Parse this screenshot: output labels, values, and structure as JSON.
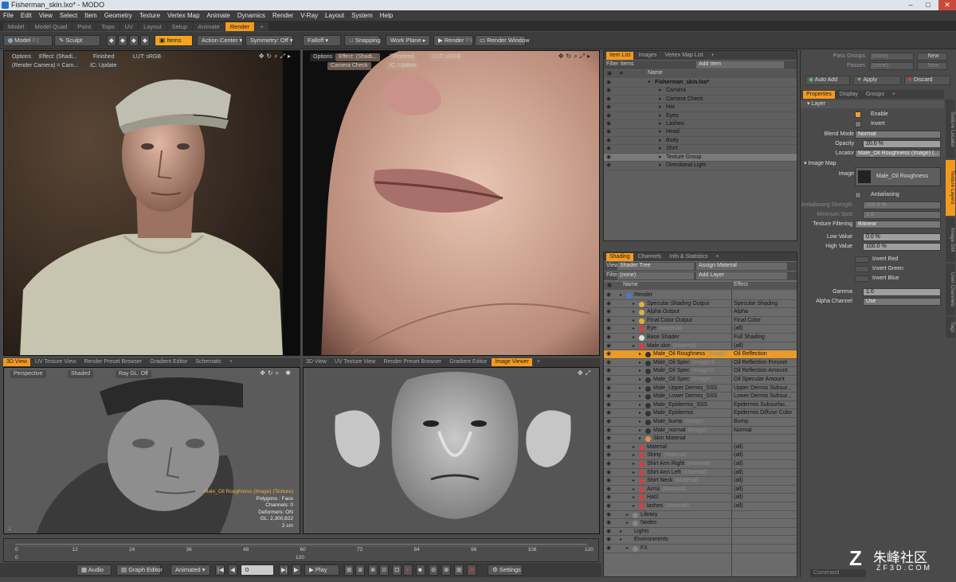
{
  "window": {
    "title": "Fisherman_skin.lxo* - MODO"
  },
  "menu": [
    "File",
    "Edit",
    "View",
    "Select",
    "Item",
    "Geometry",
    "Texture",
    "Vertex Map",
    "Animate",
    "Dynamics",
    "Render",
    "V-Ray",
    "Layout",
    "System",
    "Help"
  ],
  "layout_tabs": [
    "Model",
    "Model Quad",
    "Paint",
    "Topo",
    "UV",
    "Layout",
    "Setup",
    "Animate",
    "Render"
  ],
  "toolbar": {
    "model": "Model",
    "model_key": "F2",
    "sculpt": "Sculpt",
    "items": "Items",
    "action_center": "Action Center",
    "symmetry": "Symmetry: Off",
    "falloff": "Falloff",
    "snapping": "Snapping",
    "work_plane": "Work Plane",
    "render": "Render",
    "render_key": "F9",
    "render_window": "Render Window"
  },
  "vp1": {
    "options": "Options",
    "effect": "Effect: (Shadi...",
    "finished": "Finished",
    "lut": "LUT: sRGB",
    "camera": "(Render Camera) = Cam...",
    "ic": "IC: Update"
  },
  "vp2": {
    "options": "Options",
    "effect": "Effect: (Shadi...",
    "finished": "Finished",
    "lut": "LUT: sRGB",
    "camera": "Camera Check",
    "ic": "IC: Update"
  },
  "bottom_tabs_left": [
    "3D View",
    "UV Texture View",
    "Render Preset Browser",
    "Gradient Editor",
    "Schematic"
  ],
  "bottom_tabs_right": [
    "3D View",
    "UV Texture View",
    "Render Preset Browser",
    "Gradient Editor",
    "Image Viewer"
  ],
  "vp3": {
    "perspective": "Perspective",
    "shaded": "Shaded",
    "raygl": "Ray GL: Off",
    "info": [
      "Male_Oil Roughness (Image) (Texture)",
      "Polygons : Face",
      "Channels: 0",
      "Deformers: ON",
      "GL: 2,300,822",
      "2 cm"
    ]
  },
  "itemlist": {
    "tabs": [
      "Item List",
      "Images",
      "Vertex Map List"
    ],
    "filter": "Filter Items",
    "add": "Add Item",
    "col_name": "Name",
    "items": [
      {
        "name": "Fisherman_skin.lxo*",
        "indent": 0,
        "bold": true
      },
      {
        "name": "Camera",
        "indent": 1
      },
      {
        "name": "Camera Check",
        "indent": 1
      },
      {
        "name": "Hat",
        "indent": 1
      },
      {
        "name": "Eyes",
        "indent": 1
      },
      {
        "name": "Lashes",
        "indent": 1
      },
      {
        "name": "Head",
        "indent": 1
      },
      {
        "name": "Body",
        "indent": 1
      },
      {
        "name": "Shirt",
        "indent": 1
      },
      {
        "name": "Texture Group",
        "indent": 1
      },
      {
        "name": "Directional Light",
        "indent": 1
      }
    ]
  },
  "shading": {
    "tabs": [
      "Shading",
      "Channels",
      "Info & Statistics"
    ],
    "view_label": "View",
    "view": "Shader Tree",
    "assign": "Assign Material",
    "filter_label": "Filter",
    "filter": "(none)",
    "add_layer": "Add Layer",
    "col_name": "Name",
    "col_effect": "Effect",
    "rows": [
      {
        "name": "Render",
        "tag": "",
        "effect": "",
        "indent": 0,
        "color": "#4a78d0"
      },
      {
        "name": "Specular Shading Output",
        "tag": "",
        "effect": "Specular Shading",
        "indent": 2,
        "color": "#e0b040"
      },
      {
        "name": "Alpha Output",
        "tag": "",
        "effect": "Alpha",
        "indent": 2,
        "color": "#e0b040"
      },
      {
        "name": "Final Color Output",
        "tag": "",
        "effect": "Final Color",
        "indent": 2,
        "color": "#e0b040"
      },
      {
        "name": "Eye",
        "tag": "(Material)",
        "effect": "(all)",
        "indent": 2,
        "color": "#d04040"
      },
      {
        "name": "Base Shader",
        "tag": "",
        "effect": "Full Shading",
        "indent": 2,
        "color": "#e0e0e0"
      },
      {
        "name": "Male skin",
        "tag": "(Material)",
        "effect": "(all)",
        "indent": 2,
        "color": "#d04040"
      },
      {
        "name": "Male_Oil Roughness",
        "tag": "(Image)",
        "effect": "Oil Reflection",
        "indent": 3,
        "color": "#333",
        "selected": true
      },
      {
        "name": "Male_Oil Spec",
        "tag": "(Image)3",
        "effect": "Oil Reflection Fresnel",
        "indent": 3,
        "color": "#333"
      },
      {
        "name": "Male_Oil Spec",
        "tag": "(Image)2",
        "effect": "Oil Reflection Amount",
        "indent": 3,
        "color": "#333"
      },
      {
        "name": "Male_Oil Spec",
        "tag": "(Image)",
        "effect": "Oil Specular Amount",
        "indent": 3,
        "color": "#333"
      },
      {
        "name": "Male_Upper Dermis_SSS",
        "tag": "",
        "effect": "Upper Dermis Subsur...",
        "indent": 3,
        "color": "#333"
      },
      {
        "name": "Male_Lower Dermis_SSS",
        "tag": "",
        "effect": "Lower Dermis Subsur...",
        "indent": 3,
        "color": "#333"
      },
      {
        "name": "Male_Epidermis_SSS",
        "tag": "",
        "effect": "Epidermis Subsurfac...",
        "indent": 3,
        "color": "#333"
      },
      {
        "name": "Male_Epidermis",
        "tag": "",
        "effect": "Epidermis Diffuse Color",
        "indent": 3,
        "color": "#333"
      },
      {
        "name": "Male_bump",
        "tag": "(Image)",
        "effect": "Bump",
        "indent": 3,
        "color": "#333"
      },
      {
        "name": "Male_normal",
        "tag": "(Image)",
        "effect": "Normal",
        "indent": 3,
        "color": "#333"
      },
      {
        "name": "Skin Material",
        "tag": "",
        "effect": "",
        "indent": 3,
        "color": "#e09050"
      },
      {
        "name": "Material",
        "tag": "",
        "effect": "(all)",
        "indent": 2,
        "color": "#d04040"
      },
      {
        "name": "Shirty",
        "tag": "(Material)",
        "effect": "(all)",
        "indent": 2,
        "color": "#d04040"
      },
      {
        "name": "Shirt Arm Right",
        "tag": "(Material)",
        "effect": "(all)",
        "indent": 2,
        "color": "#d04040"
      },
      {
        "name": "Shirt Arm Left",
        "tag": "(Material)",
        "effect": "(all)",
        "indent": 2,
        "color": "#d04040"
      },
      {
        "name": "Shirt Neck",
        "tag": "(Material)",
        "effect": "(all)",
        "indent": 2,
        "color": "#d04040"
      },
      {
        "name": "Arms",
        "tag": "(Material)",
        "effect": "(all)",
        "indent": 2,
        "color": "#d04040"
      },
      {
        "name": "Hat2",
        "tag": "",
        "effect": "(all)",
        "indent": 2,
        "color": "#d04040"
      },
      {
        "name": "lashes",
        "tag": "(Material)",
        "effect": "(all)",
        "indent": 2,
        "color": "#d04040"
      },
      {
        "name": "Library",
        "tag": "",
        "effect": "",
        "indent": 1,
        "color": "#888"
      },
      {
        "name": "Nodes",
        "tag": "",
        "effect": "",
        "indent": 1,
        "color": "#888"
      },
      {
        "name": "Lights",
        "tag": "",
        "effect": "",
        "indent": 0,
        "color": ""
      },
      {
        "name": "Environments",
        "tag": "",
        "effect": "",
        "indent": 0,
        "color": ""
      },
      {
        "name": "FX",
        "tag": "",
        "effect": "",
        "indent": 1,
        "color": "#888"
      }
    ]
  },
  "right": {
    "pass_groups": "Pass Groups",
    "passes": "Passes",
    "none": "(none)",
    "new": "New",
    "auto_add": "Auto Add",
    "apply": "Apply",
    "discard": "Discard",
    "tabs": [
      "Properties",
      "Display",
      "Groups"
    ],
    "side_tabs": [
      "Texture Locator",
      "Texture Layers",
      "Image Still",
      "User Channels",
      "Tags"
    ],
    "layer": "Layer",
    "enable": "Enable",
    "invert": "Invert",
    "blend_mode_lbl": "Blend Mode",
    "blend_mode": "Normal",
    "opacity_lbl": "Opacity",
    "opacity": "20.0 %",
    "locator_lbl": "Locator",
    "locator": "Male_Oil Roughness (Image) (...",
    "image_map": "Image Map",
    "image_lbl": "Image",
    "image": "Male_Oil Roughness",
    "antialiasing": "Antialiasing",
    "aa_strength_lbl": "Antialiasing Strength",
    "aa_strength": "100.0 %",
    "min_spot_lbl": "Minimum Spot",
    "min_spot": "1.0",
    "tex_filter_lbl": "Texture Filtering",
    "tex_filter": "Bilinear",
    "low_lbl": "Low Value",
    "low": "0.0 %",
    "high_lbl": "High Value",
    "high": "100.0 %",
    "inv_red": "Invert Red",
    "inv_green": "Invert Green",
    "inv_blue": "Invert Blue",
    "gamma_lbl": "Gamma",
    "gamma": "1.0",
    "alpha_lbl": "Alpha Channel",
    "alpha": "Use",
    "command": "Command"
  },
  "timeline": {
    "ticks": [
      "0",
      "12",
      "24",
      "36",
      "48",
      "60",
      "72",
      "84",
      "96",
      "108",
      "120"
    ],
    "end": "120",
    "start": "0"
  },
  "bottom": {
    "audio": "Audio",
    "graph": "Graph Editor",
    "animated": "Animated",
    "frame": "0",
    "play": "Play",
    "settings": "Settings"
  },
  "watermark": {
    "text": "朱峰社区",
    "url": "ZF3D.COM"
  }
}
